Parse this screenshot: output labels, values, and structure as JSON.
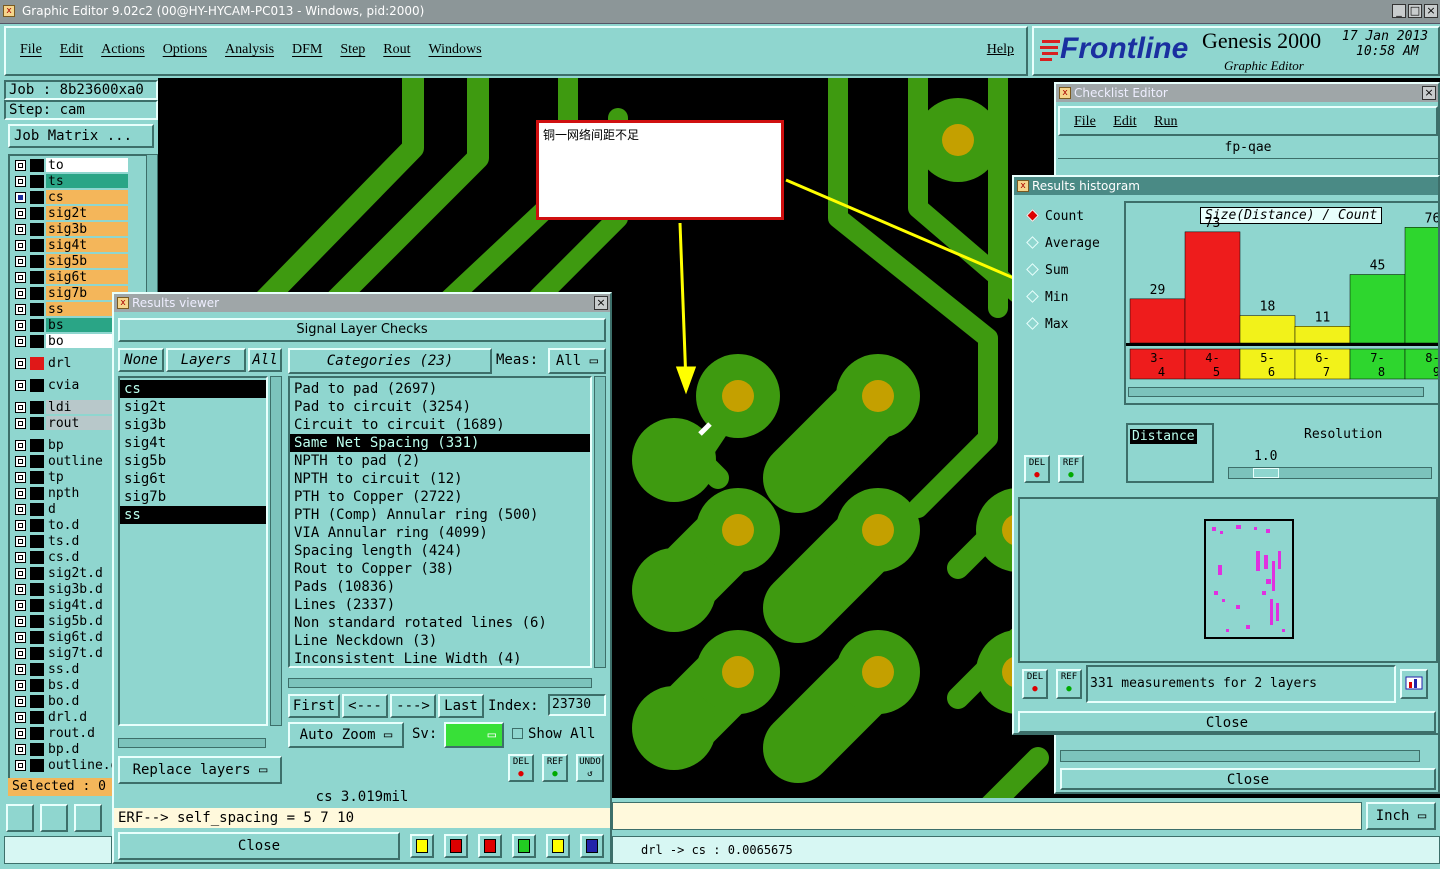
{
  "app": {
    "title": "Graphic Editor 9.02c2 (00@HY-HYCAM-PC013 - Windows, pid:2000)",
    "menu": [
      "File",
      "Edit",
      "Actions",
      "Options",
      "Analysis",
      "DFM",
      "Step",
      "Rout",
      "Windows"
    ],
    "help": "Help",
    "brand": "Frontline",
    "product": "Genesis 2000",
    "product_sub": "Graphic Editor",
    "date": "17 Jan 2013",
    "time": "10:58 AM"
  },
  "left": {
    "job": "Job : 8b23600xa0",
    "step": "Step: cam",
    "job_matrix": "Job Matrix ...",
    "selected": "Selected : 0",
    "layers": [
      {
        "name": "to",
        "color": "#ffffff"
      },
      {
        "name": "ts",
        "color": "#2aa586"
      },
      {
        "name": "cs",
        "color": "#f4b65a"
      },
      {
        "name": "sig2t",
        "color": "#f4b65a"
      },
      {
        "name": "sig3b",
        "color": "#f4b65a"
      },
      {
        "name": "sig4t",
        "color": "#f4b65a"
      },
      {
        "name": "sig5b",
        "color": "#f4b65a"
      },
      {
        "name": "sig6t",
        "color": "#f4b65a"
      },
      {
        "name": "sig7b",
        "color": "#f4b65a"
      },
      {
        "name": "ss",
        "color": "#f4b65a"
      },
      {
        "name": "bs",
        "color": "#2aa586"
      },
      {
        "name": "bo",
        "color": "#ffffff"
      }
    ],
    "layers2": [
      "drl"
    ],
    "layers3": [
      "cvia"
    ],
    "layers4": [
      "ldi",
      "rout"
    ],
    "layers5": [
      "bp",
      "outline",
      "tp",
      "npth",
      "d",
      "to.d",
      "ts.d",
      "cs.d",
      "sig2t.d",
      "sig3b.d",
      "sig4t.d",
      "sig5b.d",
      "sig6t.d",
      "sig7t.d",
      "ss.d",
      "bs.d",
      "bo.d",
      "drl.d",
      "rout.d",
      "bp.d",
      "outline.d"
    ]
  },
  "note": {
    "text": "铜一网络间距不足"
  },
  "results_viewer": {
    "title": "Results viewer",
    "heading": "Signal Layer Checks",
    "none": "None",
    "layers_label": "Layers",
    "all": "All",
    "categories_label": "Categories (23)",
    "meas_label": "Meas:",
    "meas_value": "All",
    "layers": [
      "cs",
      "sig2t",
      "sig3b",
      "sig4t",
      "sig5b",
      "sig6t",
      "sig7b",
      "ss"
    ],
    "categories": [
      "Pad to pad (2697)",
      "Pad to circuit (3254)",
      "Circuit to circuit (1689)",
      "Same Net Spacing (331)",
      "NPTH to pad (2)",
      "NPTH to circuit (12)",
      "PTH to Copper (2722)",
      "PTH (Comp) Annular ring (500)",
      "VIA Annular ring (4099)",
      "Spacing length (424)",
      "Rout to Copper (38)",
      "Pads (10836)",
      "Lines (2337)",
      "Non standard rotated lines (6)",
      "Line Neckdown (3)",
      "Inconsistent Line Width (4)"
    ],
    "first": "First",
    "prev": "<---",
    "next": "--->",
    "last": "Last",
    "index_label": "Index:",
    "index_value": "23730",
    "auto_zoom": "Auto Zoom",
    "sv_label": "Sv:",
    "show_all": "Show All",
    "replace_layers": "Replace layers",
    "del": "DEL",
    "ref": "REF",
    "undo": "UNDO",
    "status": "cs 3.019mil",
    "erf": "ERF--> self_spacing = 5 7 10",
    "close": "Close"
  },
  "checklist": {
    "title": "Checklist Editor",
    "menu": [
      "File",
      "Edit",
      "Run"
    ],
    "name": "fp-qae",
    "close": "Close"
  },
  "histogram": {
    "title": "Results histogram",
    "options": [
      "Count",
      "Average",
      "Sum",
      "Min",
      "Max"
    ],
    "chart_title": "Size(Distance) / Count",
    "distance": "Distance",
    "resolution": "Resolution",
    "resolution_value": "1.0",
    "del": "DEL",
    "ref": "REF",
    "measurements": "331 measurements for 2 layers",
    "close": "Close"
  },
  "chart_data": {
    "type": "bar",
    "title": "Size(Distance) / Count",
    "categories": [
      "3-4",
      "4-5",
      "5-6",
      "6-7",
      "7-8",
      "8-9"
    ],
    "values": [
      29,
      73,
      18,
      11,
      45,
      76
    ],
    "colors": [
      "#ee1c1c",
      "#ee1c1c",
      "#f2f21a",
      "#f2f21a",
      "#2ed62e",
      "#2ed62e"
    ]
  },
  "status": {
    "units": "Inch",
    "coords": "drl -> cs : 0.0065675"
  }
}
